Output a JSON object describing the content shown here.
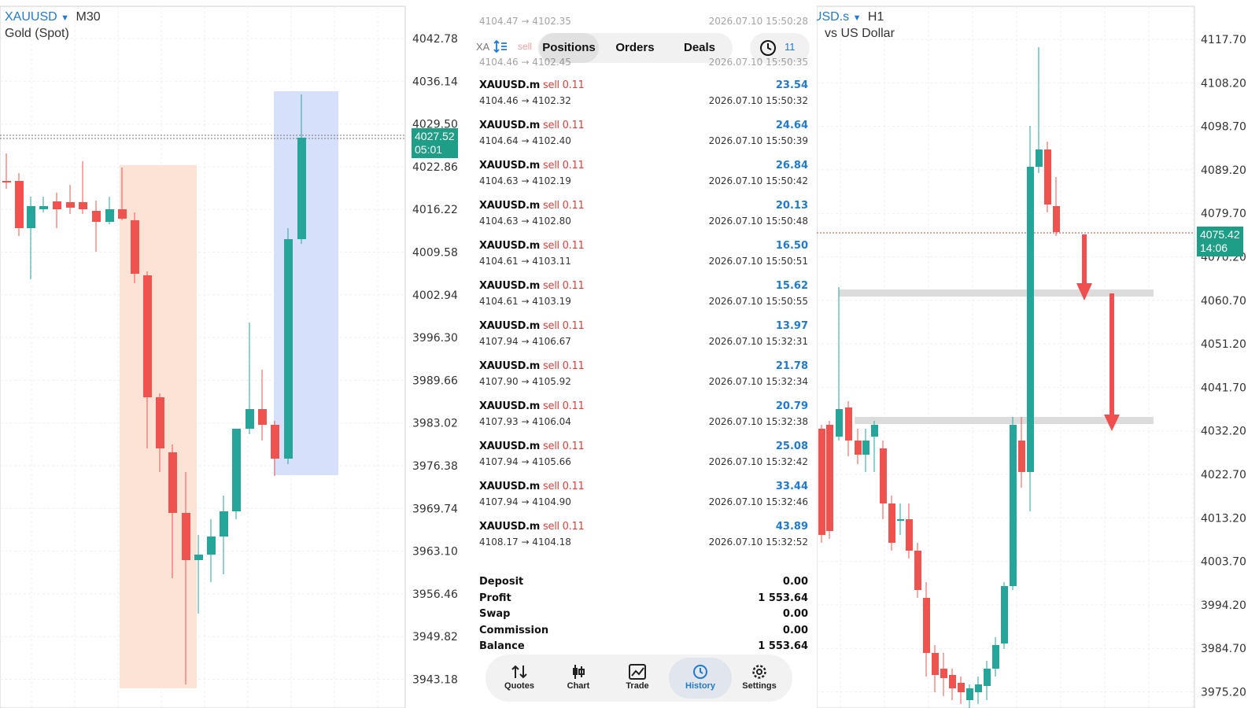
{
  "left_chart": {
    "symbol": "XAUUSD",
    "timeframe": "M30",
    "description": "Gold (Spot)",
    "price_labels": [
      "4042.78",
      "4036.14",
      "4029.50",
      "4022.86",
      "4016.22",
      "4009.58",
      "4002.94",
      "3996.30",
      "3989.66",
      "3983.02",
      "3976.38",
      "3969.74",
      "3963.10",
      "3956.46",
      "3949.82",
      "3943.18"
    ],
    "current_price": "4027.52",
    "countdown": "05:01",
    "colors": {
      "up": "#26a69a",
      "down": "#ef5350",
      "red_zone": "#fde2d6",
      "blue_zone": "#d6e0fb",
      "price_tag": "#1f9e87"
    }
  },
  "right_chart": {
    "symbol_partial": "XAUUSD.s",
    "timeframe": "H1",
    "description_partial": "vs US Dollar",
    "price_labels": [
      "4117.70",
      "4108.20",
      "4098.70",
      "4089.20",
      "4079.70",
      "4070.20",
      "4060.70",
      "4051.20",
      "4041.70",
      "4032.20",
      "4022.70",
      "4013.20",
      "4003.70",
      "3994.20",
      "3984.70",
      "3975.20"
    ],
    "current_price": "4075.42",
    "countdown": "14:06",
    "colors": {
      "arrow": "#f04f4f",
      "band": "#dcdcdc"
    }
  },
  "history": {
    "filter_label": "XA",
    "sort_icon": "sort-icon",
    "tabs": [
      "Positions",
      "Orders",
      "Deals"
    ],
    "active_tab": "Positions",
    "clock_icon": "clock-icon",
    "count": "11",
    "partial_row": {
      "prices_top": "4104.47 → 4102.35",
      "time_top": "2026.07.10 15:50:28",
      "side": "sell",
      "prices": "4104.46 → 4102.45",
      "time": "2026.07.10 15:50:35"
    },
    "deals": [
      {
        "symbol": "XAUUSD.m",
        "side": "sell 0.11",
        "prices": "4104.46 → 4102.32",
        "profit": "23.54",
        "time": "2026.07.10 15:50:32"
      },
      {
        "symbol": "XAUUSD.m",
        "side": "sell 0.11",
        "prices": "4104.64 → 4102.40",
        "profit": "24.64",
        "time": "2026.07.10 15:50:39"
      },
      {
        "symbol": "XAUUSD.m",
        "side": "sell 0.11",
        "prices": "4104.63 → 4102.19",
        "profit": "26.84",
        "time": "2026.07.10 15:50:42"
      },
      {
        "symbol": "XAUUSD.m",
        "side": "sell 0.11",
        "prices": "4104.63 → 4102.80",
        "profit": "20.13",
        "time": "2026.07.10 15:50:48"
      },
      {
        "symbol": "XAUUSD.m",
        "side": "sell 0.11",
        "prices": "4104.61 → 4103.11",
        "profit": "16.50",
        "time": "2026.07.10 15:50:51"
      },
      {
        "symbol": "XAUUSD.m",
        "side": "sell 0.11",
        "prices": "4104.61 → 4103.19",
        "profit": "15.62",
        "time": "2026.07.10 15:50:55"
      },
      {
        "symbol": "XAUUSD.m",
        "side": "sell 0.11",
        "prices": "4107.94 → 4106.67",
        "profit": "13.97",
        "time": "2026.07.10 15:32:31"
      },
      {
        "symbol": "XAUUSD.m",
        "side": "sell 0.11",
        "prices": "4107.90 → 4105.92",
        "profit": "21.78",
        "time": "2026.07.10 15:32:34"
      },
      {
        "symbol": "XAUUSD.m",
        "side": "sell 0.11",
        "prices": "4107.93 → 4106.04",
        "profit": "20.79",
        "time": "2026.07.10 15:32:38"
      },
      {
        "symbol": "XAUUSD.m",
        "side": "sell 0.11",
        "prices": "4107.94 → 4105.66",
        "profit": "25.08",
        "time": "2026.07.10 15:32:42"
      },
      {
        "symbol": "XAUUSD.m",
        "side": "sell 0.11",
        "prices": "4107.94 → 4104.90",
        "profit": "33.44",
        "time": "2026.07.10 15:32:46"
      },
      {
        "symbol": "XAUUSD.m",
        "side": "sell 0.11",
        "prices": "4108.17 → 4104.18",
        "profit": "43.89",
        "time": "2026.07.10 15:32:52"
      }
    ],
    "summary": [
      {
        "label": "Deposit",
        "value": "0.00"
      },
      {
        "label": "Profit",
        "value": "1 553.64"
      },
      {
        "label": "Swap",
        "value": "0.00"
      },
      {
        "label": "Commission",
        "value": "0.00"
      },
      {
        "label": "Balance",
        "value": "1 553.64"
      }
    ]
  },
  "nav": [
    {
      "label": "Quotes",
      "icon": "quotes-icon"
    },
    {
      "label": "Chart",
      "icon": "chart-icon"
    },
    {
      "label": "Trade",
      "icon": "trade-icon"
    },
    {
      "label": "History",
      "icon": "history-icon"
    },
    {
      "label": "Settings",
      "icon": "gear-icon"
    }
  ],
  "active_nav": "History"
}
